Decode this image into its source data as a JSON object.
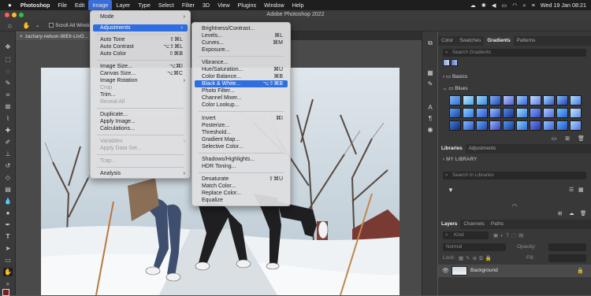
{
  "menubar": {
    "apple_icon": "apple-icon",
    "items": [
      "Photoshop",
      "File",
      "Edit",
      "Image",
      "Layer",
      "Type",
      "Select",
      "Filter",
      "3D",
      "View",
      "Plugins",
      "Window",
      "Help"
    ],
    "datetime": "Wed 19 Jan  08:21"
  },
  "window": {
    "title": "Adobe Photoshop 2022"
  },
  "options_bar": {
    "scroll_all_windows": "Scroll All Windows"
  },
  "document": {
    "tab": "zachary-nelson-98Elr-LIvO..."
  },
  "image_menu": {
    "items": [
      {
        "label": "Mode",
        "submenu": true
      },
      {
        "label": "Adjustments",
        "submenu": true,
        "highlighted": true
      },
      {
        "label": "Auto Tone",
        "shortcut": "⇧⌘L"
      },
      {
        "label": "Auto Contrast",
        "shortcut": "⌥⇧⌘L"
      },
      {
        "label": "Auto Color",
        "shortcut": "⇧⌘B"
      },
      {
        "label": "Image Size...",
        "shortcut": "⌥⌘I"
      },
      {
        "label": "Canvas Size...",
        "shortcut": "⌥⌘C"
      },
      {
        "label": "Image Rotation",
        "submenu": true
      },
      {
        "label": "Crop",
        "disabled": true
      },
      {
        "label": "Trim..."
      },
      {
        "label": "Reveal All",
        "disabled": true
      },
      {
        "label": "Duplicate..."
      },
      {
        "label": "Apply Image..."
      },
      {
        "label": "Calculations..."
      },
      {
        "label": "Variables",
        "submenu": true,
        "disabled": true
      },
      {
        "label": "Apply Data Set...",
        "disabled": true
      },
      {
        "label": "Trap...",
        "disabled": true
      },
      {
        "label": "Analysis",
        "submenu": true
      }
    ]
  },
  "adjustments_menu": {
    "items": [
      {
        "label": "Brightness/Contrast..."
      },
      {
        "label": "Levels...",
        "shortcut": "⌘L"
      },
      {
        "label": "Curves...",
        "shortcut": "⌘M"
      },
      {
        "label": "Exposure..."
      },
      {
        "label": "Vibrance..."
      },
      {
        "label": "Hue/Saturation...",
        "shortcut": "⌘U"
      },
      {
        "label": "Color Balance...",
        "shortcut": "⌘B"
      },
      {
        "label": "Black & White...",
        "shortcut": "⌥⇧⌘B",
        "highlighted": true
      },
      {
        "label": "Photo Filter..."
      },
      {
        "label": "Channel Mixer..."
      },
      {
        "label": "Color Lookup..."
      },
      {
        "label": "Invert",
        "shortcut": "⌘I"
      },
      {
        "label": "Posterize..."
      },
      {
        "label": "Threshold..."
      },
      {
        "label": "Gradient Map..."
      },
      {
        "label": "Selective Color..."
      },
      {
        "label": "Shadows/Highlights..."
      },
      {
        "label": "HDR Toning..."
      },
      {
        "label": "Desaturate",
        "shortcut": "⇧⌘U"
      },
      {
        "label": "Match Color..."
      },
      {
        "label": "Replace Color..."
      },
      {
        "label": "Equalize"
      }
    ]
  },
  "gradients_panel": {
    "tabs": [
      "Color",
      "Swatches",
      "Gradients",
      "Patterns"
    ],
    "active_tab": "Gradients",
    "search_placeholder": "Search Gradients",
    "groups": [
      "Basics",
      "Blues"
    ]
  },
  "libraries_panel": {
    "tabs": [
      "Libraries",
      "Adjustments"
    ],
    "active_tab": "Libraries",
    "library": "MY LIBRARY",
    "search_placeholder": "Search In Libraries"
  },
  "layers_panel": {
    "tabs": [
      "Layers",
      "Channels",
      "Paths"
    ],
    "active_tab": "Layers",
    "filter_kind": "Kind",
    "blend_mode": "Normal",
    "opacity_label": "Opacity:",
    "lock_label": "Lock:",
    "fill_label": "Fill:",
    "layer_name": "Background"
  }
}
